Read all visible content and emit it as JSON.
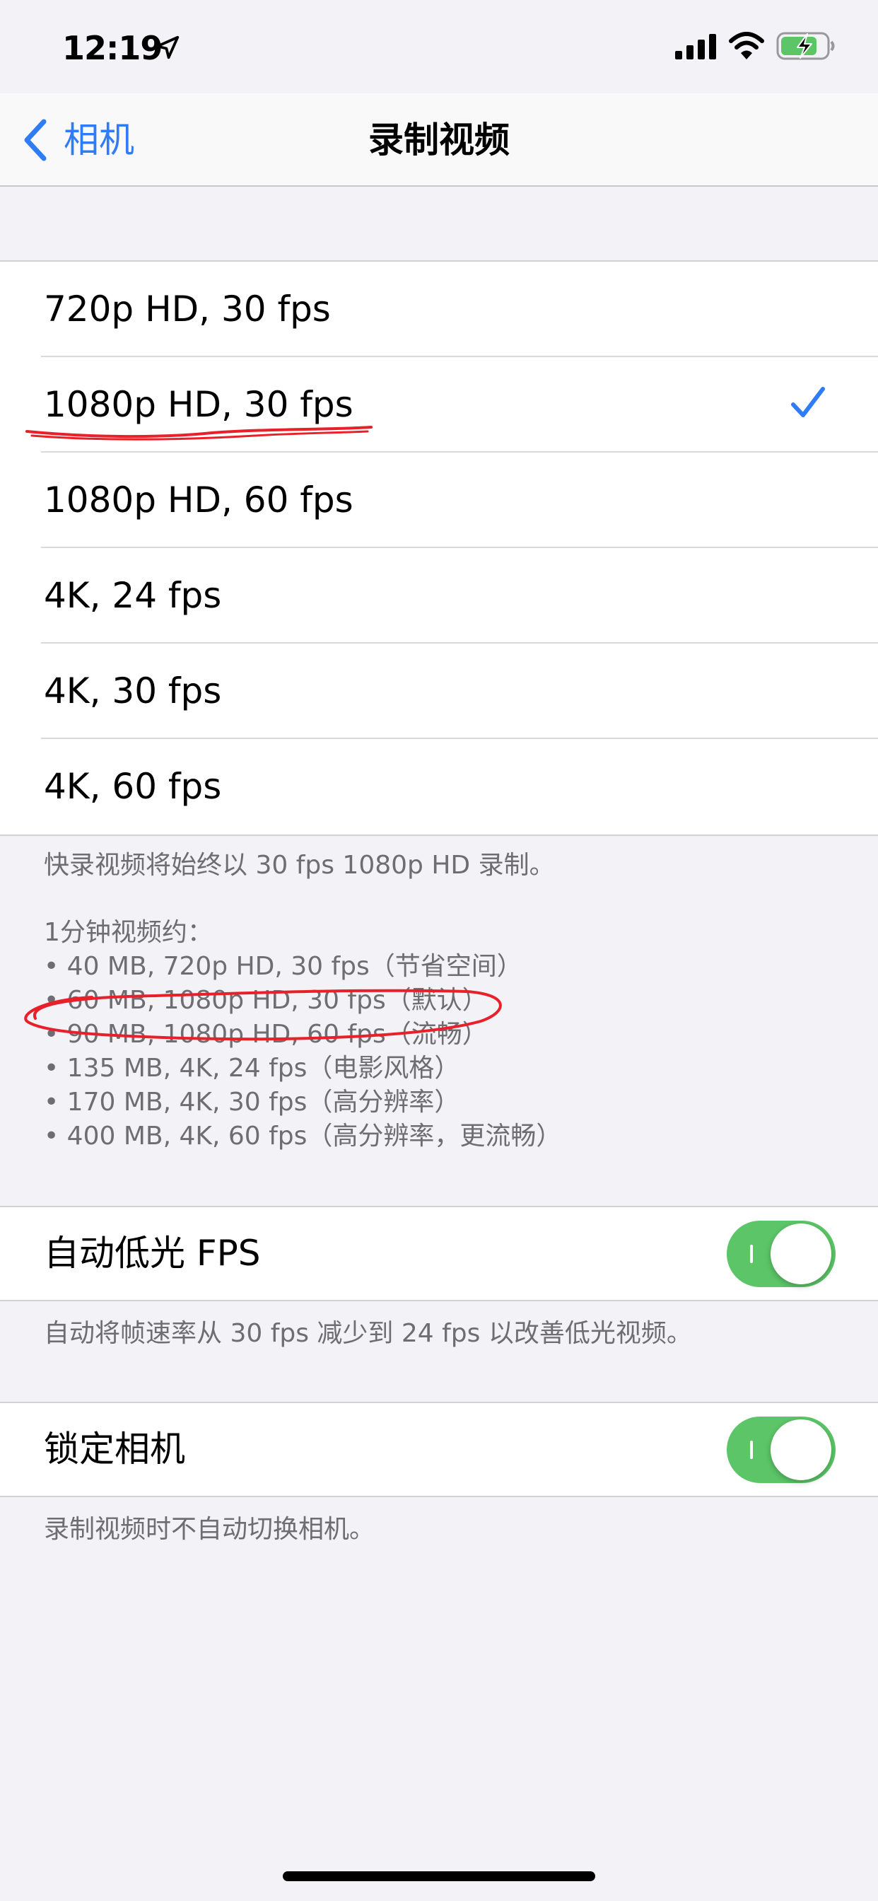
{
  "status_bar": {
    "time": "12:19",
    "icons": [
      "location-arrow-icon",
      "cellular-signal-icon",
      "wifi-icon",
      "battery-charging-icon"
    ]
  },
  "nav": {
    "back_label": "相机",
    "title": "录制视频"
  },
  "resolution_options": [
    {
      "label": "720p HD, 30 fps",
      "selected": false
    },
    {
      "label": "1080p HD, 30 fps",
      "selected": true
    },
    {
      "label": "1080p HD, 60 fps",
      "selected": false
    },
    {
      "label": "4K, 24 fps",
      "selected": false
    },
    {
      "label": "4K, 30 fps",
      "selected": false
    },
    {
      "label": "4K, 60 fps",
      "selected": false
    }
  ],
  "footer": {
    "quick_record_note": "快录视频将始终以 30 fps 1080p HD 录制。",
    "size_heading": "1分钟视频约：",
    "size_items": [
      "• 40 MB, 720p HD, 30 fps（节省空间）",
      "• 60 MB, 1080p HD, 30 fps（默认）",
      "• 90 MB, 1080p HD, 60 fps（流畅）",
      "• 135 MB, 4K, 24 fps（电影风格）",
      "• 170 MB, 4K, 30 fps（高分辨率）",
      "• 400 MB, 4K, 60 fps（高分辨率，更流畅）"
    ]
  },
  "auto_low_light": {
    "label": "自动低光 FPS",
    "on": true,
    "description": "自动将帧速率从 30 fps 减少到 24 fps 以改善低光视频。"
  },
  "lock_camera": {
    "label": "锁定相机",
    "on": true,
    "description": "录制视频时不自动切换相机。"
  },
  "colors": {
    "accent": "#2f7cf6",
    "toggle_on": "#5bc567",
    "background": "#f2f2f7",
    "secondary_text": "#6d6d72",
    "annotation_red": "#e8202a"
  }
}
